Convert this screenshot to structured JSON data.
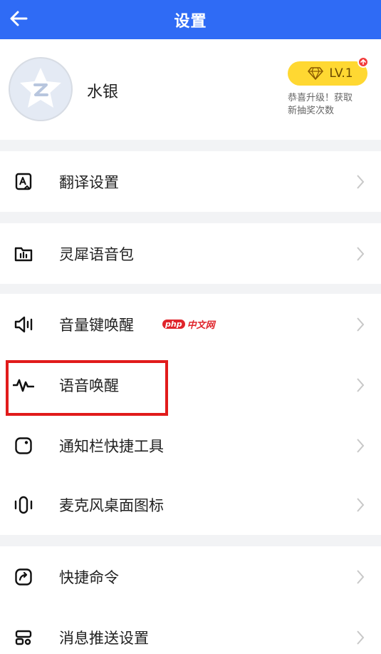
{
  "header": {
    "title": "设置",
    "back_icon": "arrow-left-icon",
    "color": "#2F6BF5"
  },
  "profile": {
    "username": "水银",
    "avatar_icon": "qq-star-avatar-icon",
    "level_badge": "LV.1",
    "level_badge_color": "#FFD832",
    "upgrade_line1": "恭喜升级！获取",
    "upgrade_line2": "新抽奖次数"
  },
  "settings": [
    {
      "label": "翻译设置",
      "icon": "translate-icon"
    },
    {
      "label": "灵犀语音包",
      "icon": "voice-pack-folder-icon"
    },
    {
      "label": "音量键唤醒",
      "icon": "volume-key-icon"
    },
    {
      "label": "语音唤醒",
      "icon": "voice-wave-icon"
    },
    {
      "label": "通知栏快捷工具",
      "icon": "notification-shortcut-icon"
    },
    {
      "label": "麦克风桌面图标",
      "icon": "microphone-desktop-icon"
    },
    {
      "label": "快捷命令",
      "icon": "shortcut-command-icon"
    },
    {
      "label": "消息推送设置",
      "icon": "push-settings-icon"
    }
  ],
  "watermark": {
    "pill": "php",
    "text": "中文网"
  },
  "highlight_color": "#E11B1B"
}
